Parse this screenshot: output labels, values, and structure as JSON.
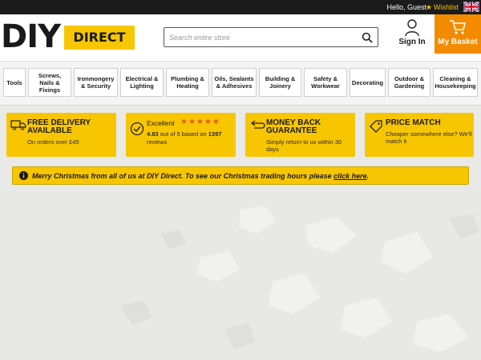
{
  "topbar": {
    "greeting": "Hello, Guest",
    "wishlist": "Wishlist",
    "flag_icon": "uk-flag-icon"
  },
  "header": {
    "logo_part1": "DIY",
    "logo_part2": "DIRECT",
    "search_placeholder": "Search entire store",
    "signin_label": "Sign In",
    "basket_label": "My Basket"
  },
  "nav": {
    "items": [
      "Tools",
      "Screws, Nails & Fixings",
      "Ironmongery & Security",
      "Electrical & Lighting",
      "Plumbing & Heating",
      "Oils, Sealants & Adhesives",
      "Building & Joinery",
      "Safety & Workwear",
      "Decorating",
      "Outdoor & Gardening",
      "Cleaning & Housekeeping"
    ]
  },
  "usps": {
    "delivery": {
      "title_line1": "FREE DELIVERY",
      "title_line2": "AVAILABLE",
      "sub": "On orders over £45",
      "icon": "truck-icon"
    },
    "rating": {
      "label": "Excellent",
      "stars": "★★★★★",
      "score": "4.83",
      "text_mid": " out of 5 based on ",
      "count": "1397",
      "text_end": "reviews",
      "icon": "check-badge-icon"
    },
    "money_back": {
      "title_line1": "MONEY BACK",
      "title_line2": "GUARANTEE",
      "sub_line1": "Simply return to us within 30",
      "sub_line2": "days",
      "icon": "return-arrow-icon"
    },
    "price_match": {
      "title": "PRICE MATCH",
      "sub_line1": "Cheaper somewhere else? We'll",
      "sub_line2": "match it",
      "icon": "price-tag-icon"
    }
  },
  "notice": {
    "text": "Merry Christmas from all of us at DIY Direct. To see our Christmas trading hours please ",
    "link": "click here",
    "end": ".",
    "icon": "info-icon"
  },
  "colors": {
    "accent_yellow": "#f7c600",
    "basket_orange": "#f28b00",
    "topbar_dark": "#1b1b1b",
    "star_red": "#e05a2b"
  }
}
